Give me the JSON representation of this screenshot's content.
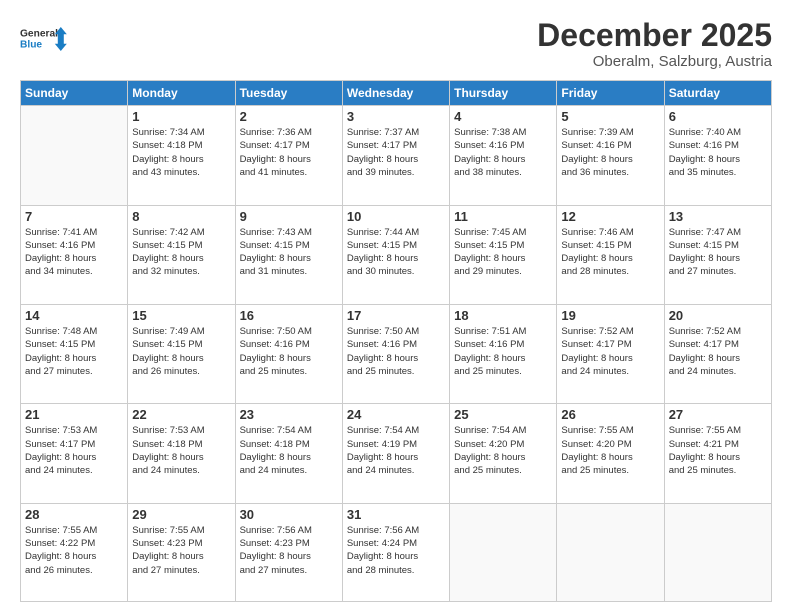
{
  "header": {
    "logo_line1": "General",
    "logo_line2": "Blue",
    "month": "December 2025",
    "location": "Oberalm, Salzburg, Austria"
  },
  "weekdays": [
    "Sunday",
    "Monday",
    "Tuesday",
    "Wednesday",
    "Thursday",
    "Friday",
    "Saturday"
  ],
  "weeks": [
    [
      {
        "day": "",
        "info": ""
      },
      {
        "day": "1",
        "info": "Sunrise: 7:34 AM\nSunset: 4:18 PM\nDaylight: 8 hours\nand 43 minutes."
      },
      {
        "day": "2",
        "info": "Sunrise: 7:36 AM\nSunset: 4:17 PM\nDaylight: 8 hours\nand 41 minutes."
      },
      {
        "day": "3",
        "info": "Sunrise: 7:37 AM\nSunset: 4:17 PM\nDaylight: 8 hours\nand 39 minutes."
      },
      {
        "day": "4",
        "info": "Sunrise: 7:38 AM\nSunset: 4:16 PM\nDaylight: 8 hours\nand 38 minutes."
      },
      {
        "day": "5",
        "info": "Sunrise: 7:39 AM\nSunset: 4:16 PM\nDaylight: 8 hours\nand 36 minutes."
      },
      {
        "day": "6",
        "info": "Sunrise: 7:40 AM\nSunset: 4:16 PM\nDaylight: 8 hours\nand 35 minutes."
      }
    ],
    [
      {
        "day": "7",
        "info": "Sunrise: 7:41 AM\nSunset: 4:16 PM\nDaylight: 8 hours\nand 34 minutes."
      },
      {
        "day": "8",
        "info": "Sunrise: 7:42 AM\nSunset: 4:15 PM\nDaylight: 8 hours\nand 32 minutes."
      },
      {
        "day": "9",
        "info": "Sunrise: 7:43 AM\nSunset: 4:15 PM\nDaylight: 8 hours\nand 31 minutes."
      },
      {
        "day": "10",
        "info": "Sunrise: 7:44 AM\nSunset: 4:15 PM\nDaylight: 8 hours\nand 30 minutes."
      },
      {
        "day": "11",
        "info": "Sunrise: 7:45 AM\nSunset: 4:15 PM\nDaylight: 8 hours\nand 29 minutes."
      },
      {
        "day": "12",
        "info": "Sunrise: 7:46 AM\nSunset: 4:15 PM\nDaylight: 8 hours\nand 28 minutes."
      },
      {
        "day": "13",
        "info": "Sunrise: 7:47 AM\nSunset: 4:15 PM\nDaylight: 8 hours\nand 27 minutes."
      }
    ],
    [
      {
        "day": "14",
        "info": "Sunrise: 7:48 AM\nSunset: 4:15 PM\nDaylight: 8 hours\nand 27 minutes."
      },
      {
        "day": "15",
        "info": "Sunrise: 7:49 AM\nSunset: 4:15 PM\nDaylight: 8 hours\nand 26 minutes."
      },
      {
        "day": "16",
        "info": "Sunrise: 7:50 AM\nSunset: 4:16 PM\nDaylight: 8 hours\nand 25 minutes."
      },
      {
        "day": "17",
        "info": "Sunrise: 7:50 AM\nSunset: 4:16 PM\nDaylight: 8 hours\nand 25 minutes."
      },
      {
        "day": "18",
        "info": "Sunrise: 7:51 AM\nSunset: 4:16 PM\nDaylight: 8 hours\nand 25 minutes."
      },
      {
        "day": "19",
        "info": "Sunrise: 7:52 AM\nSunset: 4:17 PM\nDaylight: 8 hours\nand 24 minutes."
      },
      {
        "day": "20",
        "info": "Sunrise: 7:52 AM\nSunset: 4:17 PM\nDaylight: 8 hours\nand 24 minutes."
      }
    ],
    [
      {
        "day": "21",
        "info": "Sunrise: 7:53 AM\nSunset: 4:17 PM\nDaylight: 8 hours\nand 24 minutes."
      },
      {
        "day": "22",
        "info": "Sunrise: 7:53 AM\nSunset: 4:18 PM\nDaylight: 8 hours\nand 24 minutes."
      },
      {
        "day": "23",
        "info": "Sunrise: 7:54 AM\nSunset: 4:18 PM\nDaylight: 8 hours\nand 24 minutes."
      },
      {
        "day": "24",
        "info": "Sunrise: 7:54 AM\nSunset: 4:19 PM\nDaylight: 8 hours\nand 24 minutes."
      },
      {
        "day": "25",
        "info": "Sunrise: 7:54 AM\nSunset: 4:20 PM\nDaylight: 8 hours\nand 25 minutes."
      },
      {
        "day": "26",
        "info": "Sunrise: 7:55 AM\nSunset: 4:20 PM\nDaylight: 8 hours\nand 25 minutes."
      },
      {
        "day": "27",
        "info": "Sunrise: 7:55 AM\nSunset: 4:21 PM\nDaylight: 8 hours\nand 25 minutes."
      }
    ],
    [
      {
        "day": "28",
        "info": "Sunrise: 7:55 AM\nSunset: 4:22 PM\nDaylight: 8 hours\nand 26 minutes."
      },
      {
        "day": "29",
        "info": "Sunrise: 7:55 AM\nSunset: 4:23 PM\nDaylight: 8 hours\nand 27 minutes."
      },
      {
        "day": "30",
        "info": "Sunrise: 7:56 AM\nSunset: 4:23 PM\nDaylight: 8 hours\nand 27 minutes."
      },
      {
        "day": "31",
        "info": "Sunrise: 7:56 AM\nSunset: 4:24 PM\nDaylight: 8 hours\nand 28 minutes."
      },
      {
        "day": "",
        "info": ""
      },
      {
        "day": "",
        "info": ""
      },
      {
        "day": "",
        "info": ""
      }
    ]
  ]
}
